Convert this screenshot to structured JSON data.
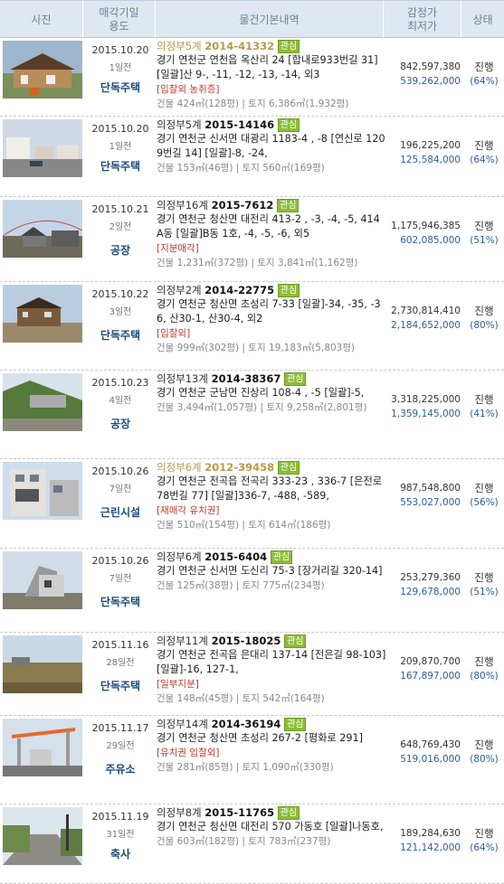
{
  "header": {
    "photo": "사진",
    "date_line1": "매각기일",
    "date_line2": "용도",
    "info": "물건기본내역",
    "price_line1": "감정가",
    "price_line2": "최저가",
    "status": "상태"
  },
  "badge_label": "관심",
  "rows": [
    {
      "date": "2015.10.20",
      "days": "1일전",
      "usage": "단독주택",
      "court": "의정부5계",
      "case_no": "2014-41332",
      "dim": true,
      "address": "경기 연천군 연천읍 옥산리 24 [합내로933번길 31] [일괄]산 9-, -11, -12, -13, -14, 외3",
      "tags": "[입찰외 농취증]",
      "area": "건물 424㎡(128평) | 토지 6,386㎡(1,932평)",
      "appraisal": "842,597,380",
      "minimum": "539,262,000",
      "status": "진행",
      "percent": "(64%)"
    },
    {
      "date": "2015.10.20",
      "days": "1일전",
      "usage": "단독주택",
      "court": "의정부5계",
      "case_no": "2015-14146",
      "dim": false,
      "address": "경기 연천군 신서면 대광리 1183-4 , -8 [연신로 1209번길 14] [일괄]-8, -24,",
      "tags": "",
      "area": "건물 153㎡(46평) | 토지 560㎡(169평)",
      "appraisal": "196,225,200",
      "minimum": "125,584,000",
      "status": "진행",
      "percent": "(64%)"
    },
    {
      "date": "2015.10.21",
      "days": "2일전",
      "usage": "공장",
      "court": "의정부16계",
      "case_no": "2015-7612",
      "dim": false,
      "address": "경기 연천군 청산면 대전리 413-2 , -3, -4, -5, 414 A동 [일괄]B동 1호, -4, -5, -6, 외5",
      "tags": "[지분매각]",
      "area": "건물 1,231㎡(372평) | 토지 3,841㎡(1,162평)",
      "appraisal": "1,175,946,385",
      "minimum": "602,085,000",
      "status": "진행",
      "percent": "(51%)"
    },
    {
      "date": "2015.10.22",
      "days": "3일전",
      "usage": "단독주택",
      "court": "의정부2계",
      "case_no": "2014-22775",
      "dim": false,
      "address": "경기 연천군 청산면 초성리 7-33 [일괄]-34, -35, -36, 산30-1, 산30-4, 외2",
      "tags": "[입찰외]",
      "area": "건물 999㎡(302평) | 토지 19,183㎡(5,803평)",
      "appraisal": "2,730,814,410",
      "minimum": "2,184,652,000",
      "status": "진행",
      "percent": "(80%)"
    },
    {
      "date": "2015.10.23",
      "days": "4일전",
      "usage": "공장",
      "court": "의정부13계",
      "case_no": "2014-38367",
      "dim": false,
      "address": "경기 연천군 군남면 진상리 108-4 , -5 [일괄]-5,",
      "tags": "",
      "area": "건물 3,494㎡(1,057평) | 토지 9,258㎡(2,801평)",
      "appraisal": "3,318,225,000",
      "minimum": "1,359,145,000",
      "status": "진행",
      "percent": "(41%)"
    },
    {
      "date": "2015.10.26",
      "days": "7일전",
      "usage": "근린시설",
      "court": "의정부6계",
      "case_no": "2012-39458",
      "dim": true,
      "address": "경기 연천군 전곡읍 전곡리 333-23 , 336-7 [은전로78번길 77] [일괄]336-7, -488, -589,",
      "tags": "[재매각 유치권]",
      "area": "건물 510㎡(154평) | 토지 614㎡(186평)",
      "appraisal": "987,548,800",
      "minimum": "553,027,000",
      "status": "진행",
      "percent": "(56%)"
    },
    {
      "date": "2015.10.26",
      "days": "7일전",
      "usage": "단독주택",
      "court": "의정부6계",
      "case_no": "2015-6404",
      "dim": false,
      "address": "경기 연천군 신서면 도신리 75-3 [장거리길 320-14]",
      "tags": "",
      "area": "건물 125㎡(38평) | 토지 775㎡(234평)",
      "appraisal": "253,279,360",
      "minimum": "129,678,000",
      "status": "진행",
      "percent": "(51%)"
    },
    {
      "date": "2015.11.16",
      "days": "28일전",
      "usage": "단독주택",
      "court": "의정부11계",
      "case_no": "2015-18025",
      "dim": false,
      "address": "경기 연천군 전곡읍 은대리 137-14 [전은길 98-103] [일괄]-16, 127-1,",
      "tags": "[일부지분]",
      "area": "건물 148㎡(45평) | 토지 542㎡(164평)",
      "appraisal": "209,870,700",
      "minimum": "167,897,000",
      "status": "진행",
      "percent": "(80%)"
    },
    {
      "date": "2015.11.17",
      "days": "29일전",
      "usage": "주유소",
      "court": "의정부14계",
      "case_no": "2014-36194",
      "dim": false,
      "address": "경기 연천군 청산면 초성리 267-2 [평화로 291]",
      "tags": "[유치권 입찰외]",
      "area": "건물 281㎡(85평) | 토지 1,090㎡(330평)",
      "appraisal": "648,769,430",
      "minimum": "519,016,000",
      "status": "진행",
      "percent": "(80%)"
    },
    {
      "date": "2015.11.19",
      "days": "31일전",
      "usage": "축사",
      "court": "의정부8계",
      "case_no": "2015-11765",
      "dim": false,
      "address": "경기 연천군 청산면 대전리 570 가동호 [일괄]나동호,",
      "tags": "",
      "area": "건물 603㎡(182평) | 토지 783㎡(237평)",
      "appraisal": "189,284,630",
      "minimum": "121,142,000",
      "status": "진행",
      "percent": "(64%)"
    }
  ]
}
